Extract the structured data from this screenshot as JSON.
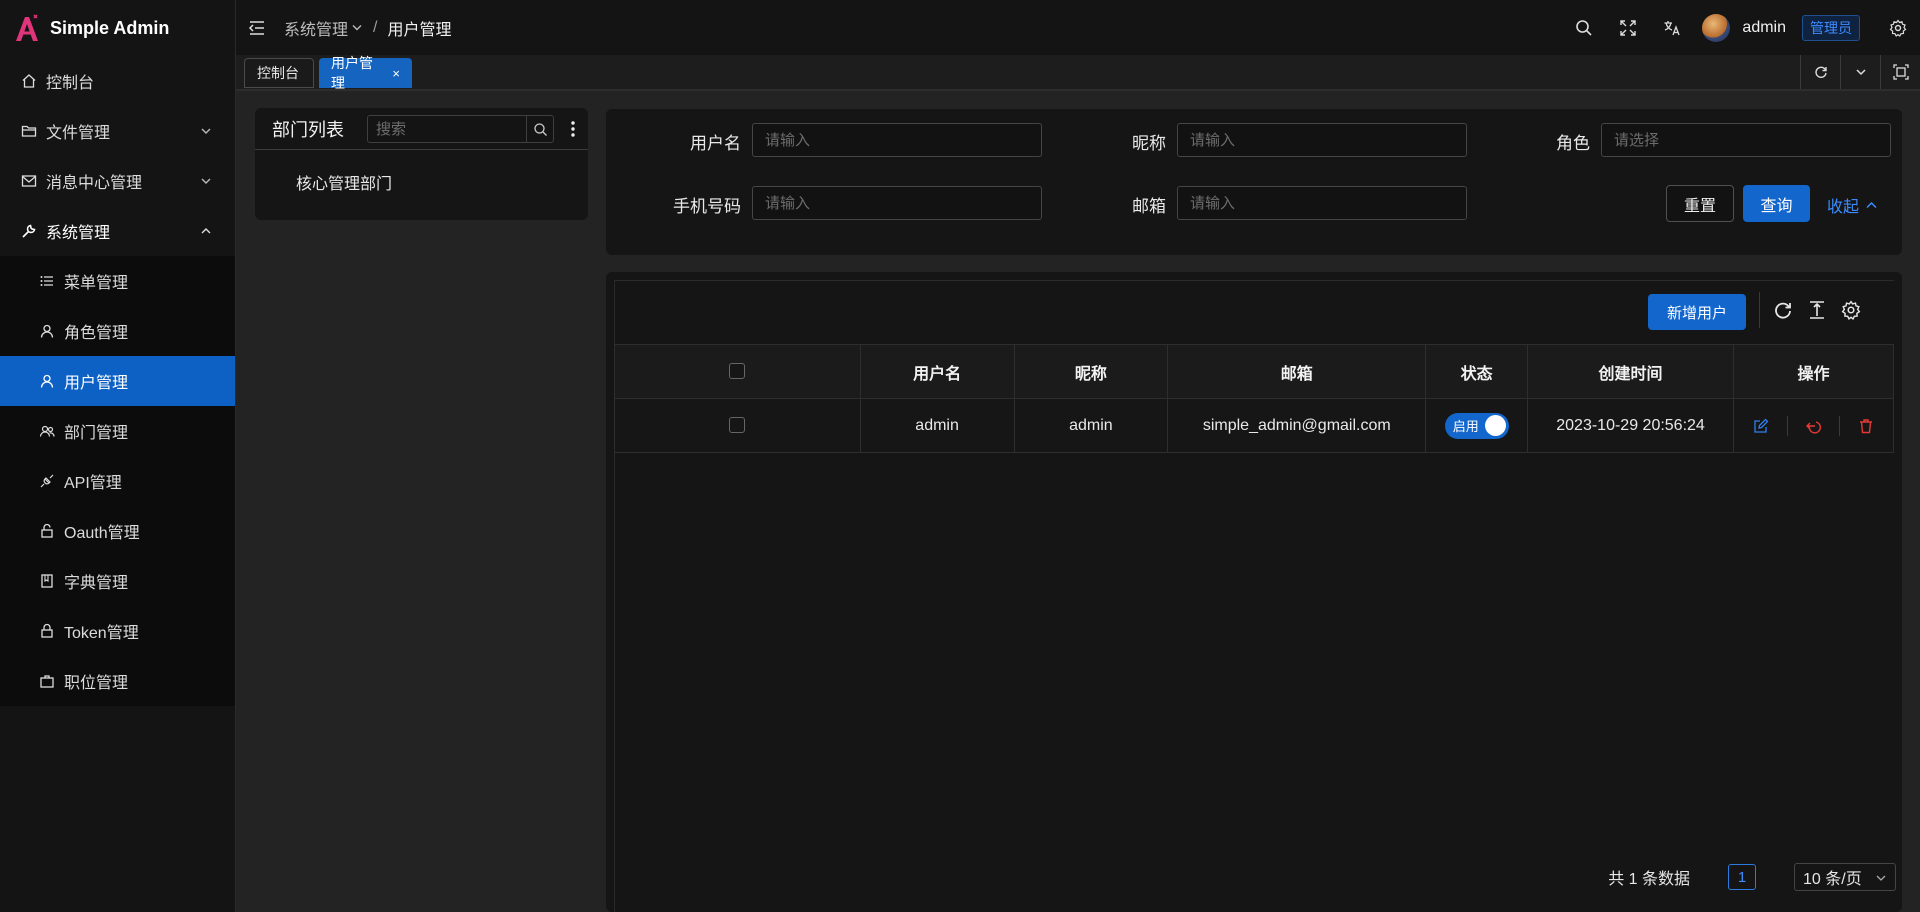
{
  "app": {
    "title": "Simple Admin"
  },
  "sidebar": {
    "items": [
      {
        "label": "控制台"
      },
      {
        "label": "文件管理"
      },
      {
        "label": "消息中心管理"
      },
      {
        "label": "系统管理"
      }
    ],
    "system_children": [
      {
        "label": "菜单管理"
      },
      {
        "label": "角色管理"
      },
      {
        "label": "用户管理"
      },
      {
        "label": "部门管理"
      },
      {
        "label": "API管理"
      },
      {
        "label": "Oauth管理"
      },
      {
        "label": "字典管理"
      },
      {
        "label": "Token管理"
      },
      {
        "label": "职位管理"
      }
    ]
  },
  "header": {
    "breadcrumb_parent": "系统管理",
    "breadcrumb_sep": "/",
    "breadcrumb_current": "用户管理",
    "user_name": "admin",
    "role_badge": "管理员"
  },
  "tabs": [
    {
      "label": "控制台"
    },
    {
      "label": "用户管理",
      "close": "×"
    }
  ],
  "dept": {
    "title": "部门列表",
    "search_placeholder": "搜索",
    "node": "核心管理部门"
  },
  "filter": {
    "username_label": "用户名",
    "username_placeholder": "请输入",
    "nickname_label": "昵称",
    "nickname_placeholder": "请输入",
    "role_label": "角色",
    "role_placeholder": "请选择",
    "mobile_label": "手机号码",
    "mobile_placeholder": "请输入",
    "email_label": "邮箱",
    "email_placeholder": "请输入",
    "reset": "重置",
    "query": "查询",
    "collapse": "收起"
  },
  "table": {
    "add_button": "新增用户",
    "columns": [
      "用户名",
      "昵称",
      "邮箱",
      "状态",
      "创建时间",
      "操作"
    ],
    "rows": [
      {
        "username": "admin",
        "nickname": "admin",
        "email": "simple_admin@gmail.com",
        "status": "启用",
        "status_on": true,
        "created": "2023-10-29 20:56:24"
      }
    ]
  },
  "pager": {
    "total": "共 1 条数据",
    "page": "1",
    "size": "10 条/页"
  },
  "colors": {
    "accent": "#1366cc",
    "logo": "#e0357a",
    "danger": "#e53935"
  }
}
